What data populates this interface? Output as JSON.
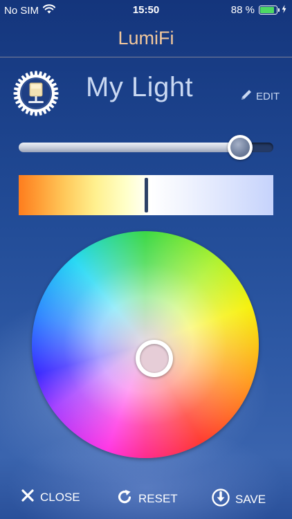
{
  "status_bar": {
    "carrier": "No SIM",
    "time": "15:50",
    "battery_percent": "88 %",
    "battery_level": 0.88,
    "battery_color": "#4cd964"
  },
  "header": {
    "title": "LumiFi",
    "title_color": "#f3c89c"
  },
  "device": {
    "name": "My Light",
    "icon": "light-bulb-gear-icon",
    "edit_label": "EDIT",
    "edit_icon": "pencil-icon"
  },
  "brightness": {
    "value_fraction": 0.87
  },
  "color_temperature": {
    "value_fraction": 0.5
  },
  "color_wheel": {
    "selected_color": "#e6cdd7",
    "handle_fraction_x": 0.54,
    "handle_fraction_y": 0.56
  },
  "toolbar": {
    "close_label": "CLOSE",
    "close_icon": "close-x-icon",
    "reset_label": "RESET",
    "reset_icon": "refresh-icon",
    "save_label": "SAVE",
    "save_icon": "download-icon"
  }
}
